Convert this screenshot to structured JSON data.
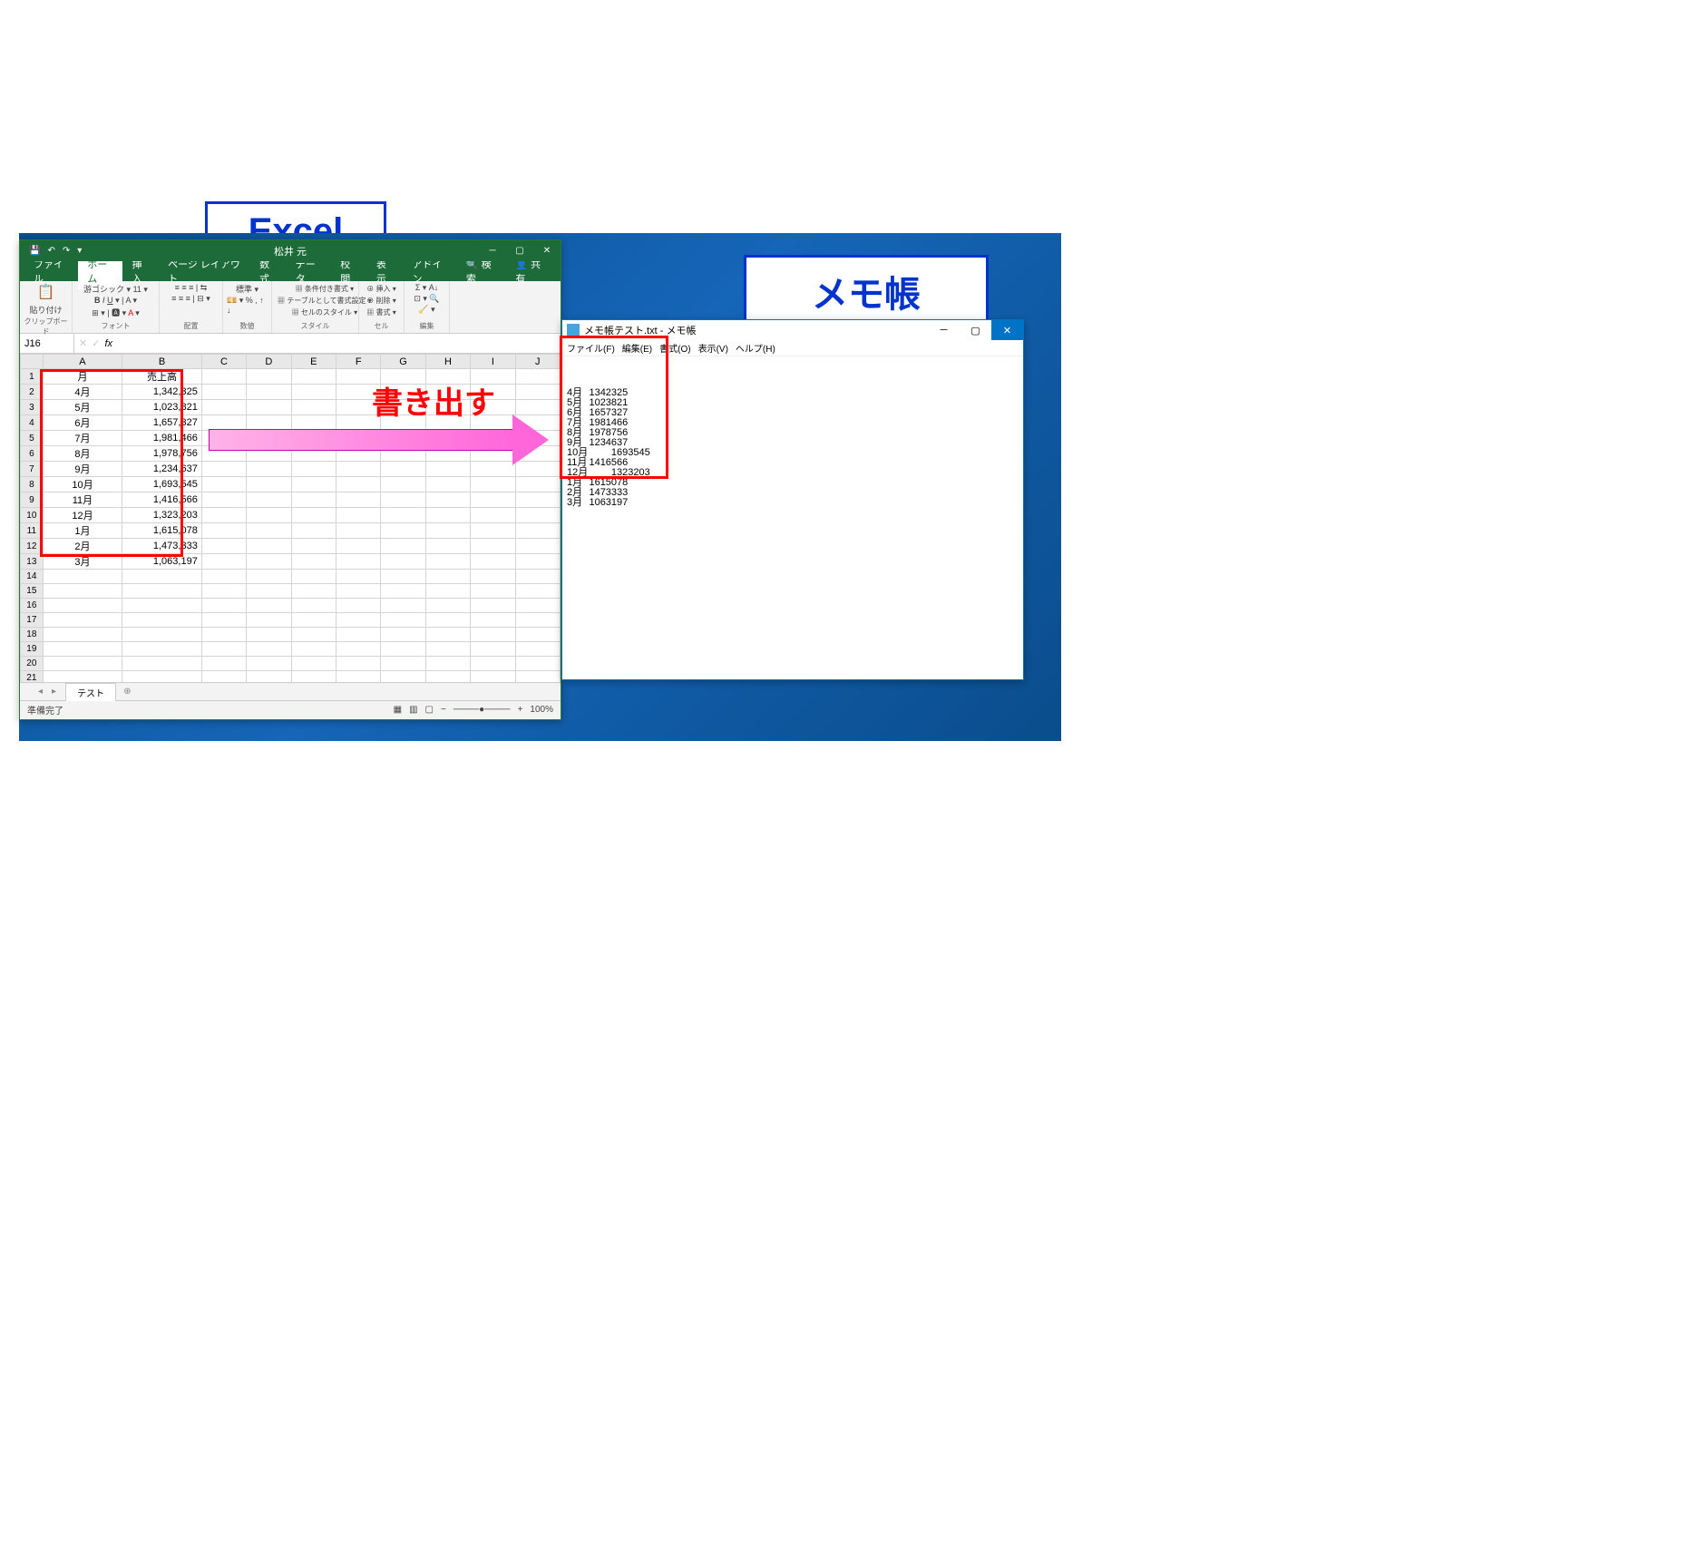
{
  "labels": {
    "excel": "Excel",
    "notepad": "メモ帳",
    "arrow": "書き出す"
  },
  "excel": {
    "user": "松井 元",
    "share": "共有",
    "tabs": [
      "ファイル",
      "ホーム",
      "挿入",
      "ページ レイアウト",
      "数式",
      "データ",
      "校閲",
      "表示",
      "アドイン"
    ],
    "search": "検索",
    "activeTab": 1,
    "ribbon": {
      "clipboard": {
        "label": "クリップボード",
        "paste": "貼り付け"
      },
      "font": {
        "label": "フォント",
        "name": "游ゴシック",
        "size": "11"
      },
      "align": {
        "label": "配置"
      },
      "number": {
        "label": "数値",
        "fmt": "標準"
      },
      "styles": {
        "label": "スタイル",
        "cond": "条件付き書式",
        "table": "テーブルとして書式設定",
        "cell": "セルのスタイル"
      },
      "cells": {
        "label": "セル",
        "insert": "挿入",
        "delete": "削除",
        "format": "書式"
      },
      "editing": {
        "label": "編集"
      }
    },
    "namebox": "J16",
    "columns": [
      "A",
      "B",
      "C",
      "D",
      "E",
      "F",
      "G",
      "H",
      "I",
      "J"
    ],
    "headerRow": {
      "A": "月",
      "B": "売上高"
    },
    "data": [
      {
        "month": "4月",
        "sales": "1,342,325"
      },
      {
        "month": "5月",
        "sales": "1,023,821"
      },
      {
        "month": "6月",
        "sales": "1,657,327"
      },
      {
        "month": "7月",
        "sales": "1,981,466"
      },
      {
        "month": "8月",
        "sales": "1,978,756"
      },
      {
        "month": "9月",
        "sales": "1,234,637"
      },
      {
        "month": "10月",
        "sales": "1,693,545"
      },
      {
        "month": "11月",
        "sales": "1,416,566"
      },
      {
        "month": "12月",
        "sales": "1,323,203"
      },
      {
        "month": "1月",
        "sales": "1,615,078"
      },
      {
        "month": "2月",
        "sales": "1,473,333"
      },
      {
        "month": "3月",
        "sales": "1,063,197"
      }
    ],
    "sheetTab": "テスト",
    "status": "準備完了",
    "zoom": "100%"
  },
  "notepad": {
    "title": "メモ帳テスト.txt - メモ帳",
    "menu": [
      "ファイル(F)",
      "編集(E)",
      "書式(O)",
      "表示(V)",
      "ヘルプ(H)"
    ],
    "lines": [
      "4月\t1342325",
      "5月\t1023821",
      "6月\t1657327",
      "7月\t1981466",
      "8月\t1978756",
      "9月\t1234637",
      "10月\t1693545",
      "11月\t1416566",
      "12月\t1323203",
      "1月\t1615078",
      "2月\t1473333",
      "3月\t1063197"
    ]
  }
}
